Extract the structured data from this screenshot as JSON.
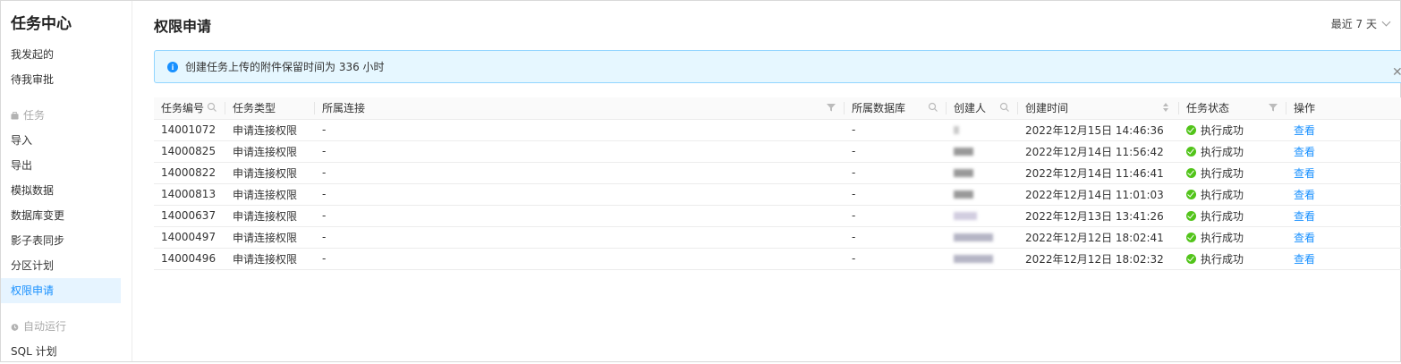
{
  "sidebar": {
    "title": "任务中心",
    "top_items": [
      {
        "label": "我发起的"
      },
      {
        "label": "待我审批"
      }
    ],
    "group_task": "任务",
    "task_items": [
      {
        "label": "导入"
      },
      {
        "label": "导出"
      },
      {
        "label": "模拟数据"
      },
      {
        "label": "数据库变更"
      },
      {
        "label": "影子表同步"
      },
      {
        "label": "分区计划"
      },
      {
        "label": "权限申请"
      }
    ],
    "group_auto": "自动运行",
    "auto_items": [
      {
        "label": "SQL 计划"
      }
    ]
  },
  "page": {
    "title": "权限申请",
    "range_label": "最近 7 天"
  },
  "alert": {
    "text": "创建任务上传的附件保留时间为 336 小时"
  },
  "colors": {
    "accent": "#1890ff",
    "success": "#52c41a",
    "alert_bg": "#e6f7ff"
  },
  "table": {
    "headers": [
      "任务编号",
      "任务类型",
      "所属连接",
      "所属数据库",
      "创建人",
      "创建时间",
      "任务状态",
      "操作"
    ],
    "rows": [
      {
        "id": "14001072",
        "type": "申请连接权限",
        "conn": "-",
        "db": "-",
        "time": "2022年12月15日 14:46:36",
        "status": "执行成功",
        "action": "查看"
      },
      {
        "id": "14000825",
        "type": "申请连接权限",
        "conn": "-",
        "db": "-",
        "time": "2022年12月14日 11:56:42",
        "status": "执行成功",
        "action": "查看"
      },
      {
        "id": "14000822",
        "type": "申请连接权限",
        "conn": "-",
        "db": "-",
        "time": "2022年12月14日 11:46:41",
        "status": "执行成功",
        "action": "查看"
      },
      {
        "id": "14000813",
        "type": "申请连接权限",
        "conn": "-",
        "db": "-",
        "time": "2022年12月14日 11:01:03",
        "status": "执行成功",
        "action": "查看"
      },
      {
        "id": "14000637",
        "type": "申请连接权限",
        "conn": "-",
        "db": "-",
        "time": "2022年12月13日 13:41:26",
        "status": "执行成功",
        "action": "查看"
      },
      {
        "id": "14000497",
        "type": "申请连接权限",
        "conn": "-",
        "db": "-",
        "time": "2022年12月12日 18:02:41",
        "status": "执行成功",
        "action": "查看"
      },
      {
        "id": "14000496",
        "type": "申请连接权限",
        "conn": "-",
        "db": "-",
        "time": "2022年12月12日 18:02:32",
        "status": "执行成功",
        "action": "查看"
      }
    ]
  }
}
